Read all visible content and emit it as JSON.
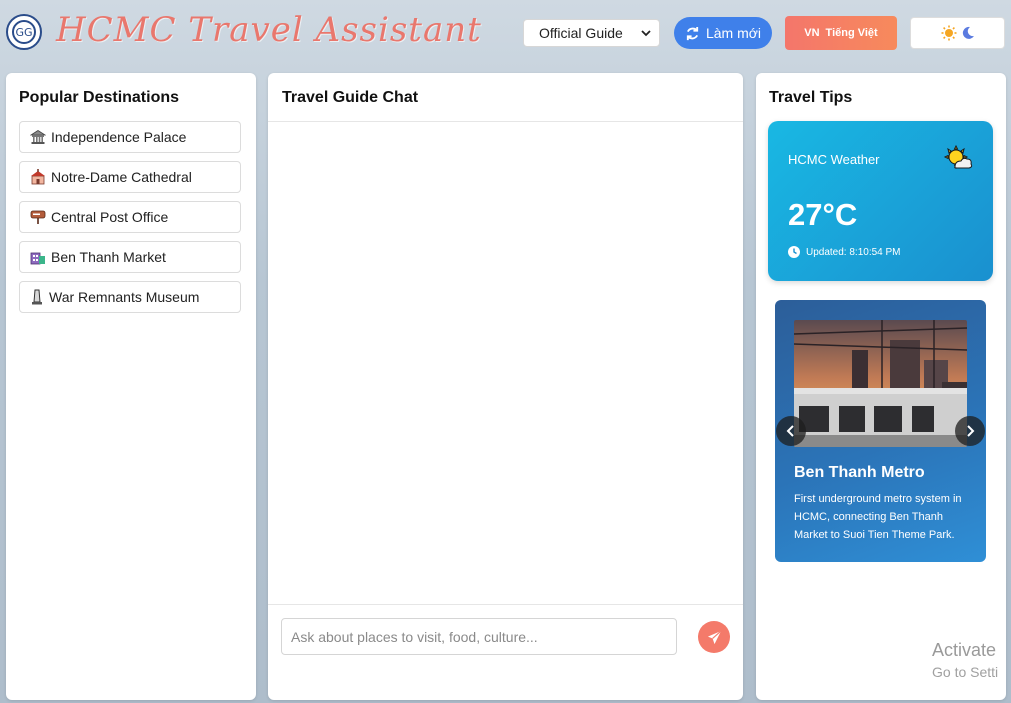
{
  "app": {
    "title": "HCMC Travel Assistant"
  },
  "header": {
    "guide_select": {
      "selected": "Official Guide"
    },
    "new_button_label": "Làm mới",
    "language_button": {
      "flag": "VN",
      "label": "Tiếng Việt"
    }
  },
  "sidebar": {
    "heading": "Popular Destinations",
    "items": [
      {
        "label": "Independence Palace",
        "icon": "landmark-icon"
      },
      {
        "label": "Notre-Dame Cathedral",
        "icon": "church-icon"
      },
      {
        "label": "Central Post Office",
        "icon": "postbox-icon"
      },
      {
        "label": "Ben Thanh Market",
        "icon": "market-icon"
      },
      {
        "label": "War Remnants Museum",
        "icon": "monument-icon"
      }
    ]
  },
  "chat": {
    "heading": "Travel Guide Chat",
    "input_placeholder": "Ask about places to visit, food, culture..."
  },
  "tips": {
    "heading": "Travel Tips",
    "weather": {
      "label": "HCMC Weather",
      "temperature": "27°C",
      "updated": "Updated: 8:10:54 PM"
    },
    "carousel": {
      "title": "Ben Thanh Metro",
      "description": "First underground metro system in HCMC, connecting Ben Thanh Market to Suoi Tien Theme Park."
    }
  },
  "os_watermark": {
    "line1": "Activate",
    "line2": "Go to Setti"
  },
  "colors": {
    "accent_blue": "#3f80ea",
    "accent_coral": "#f47a6a",
    "weather_blue": "#19b8e3"
  }
}
